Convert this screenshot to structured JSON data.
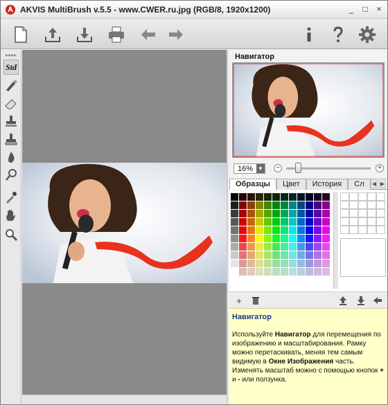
{
  "window": {
    "title": "AKVIS MultiBrush v.5.5 - www.CWER.ru.jpg (RGB/8, 1920x1200)",
    "controls": {
      "minimize": "_",
      "maximize": "□",
      "close": "×"
    }
  },
  "toolbar": {
    "buttons": [
      "new-document-icon",
      "upload-icon",
      "download-icon",
      "print-icon",
      "undo-arrow-icon",
      "redo-arrow-icon",
      "info-icon",
      "help-icon",
      "settings-gear-icon"
    ]
  },
  "tools": {
    "std_label": "Std",
    "items": [
      "brush-icon",
      "eraser-icon",
      "stamp-icon",
      "pattern-stamp-icon",
      "blur-drop-icon",
      "smudge-icon",
      "eyedropper-icon",
      "hand-icon",
      "zoom-icon"
    ]
  },
  "navigator": {
    "title": "Навигатор",
    "zoom_value": "16%",
    "zoom_minus": "−",
    "zoom_plus": "+",
    "zoom_fraction": 0.14
  },
  "tabs": {
    "items": [
      "Образцы",
      "Цвет",
      "История",
      "Сл"
    ],
    "active_index": 0,
    "left_arrow": "◀",
    "right_arrow": "▶"
  },
  "palette": {
    "add_label": "+",
    "colors": [
      "#000000",
      "#1e1e1e",
      "#3a3a3a",
      "#575757",
      "#737373",
      "#909090",
      "#acacac",
      "#c9c9c9",
      "#e5e5e5",
      "#ffffff"
    ]
  },
  "help": {
    "title": "Навигатор",
    "body_parts": [
      "Используйте ",
      "Навигатор",
      " для перемещения по изображению и масштабирования. Рамку можно перетаскивать, меняя тем самым видимую в ",
      "Окне Изображения",
      " часть. Изменять масштаб можно с помощью кнопок ",
      "+",
      " и ",
      "-",
      " или ползунка."
    ]
  }
}
